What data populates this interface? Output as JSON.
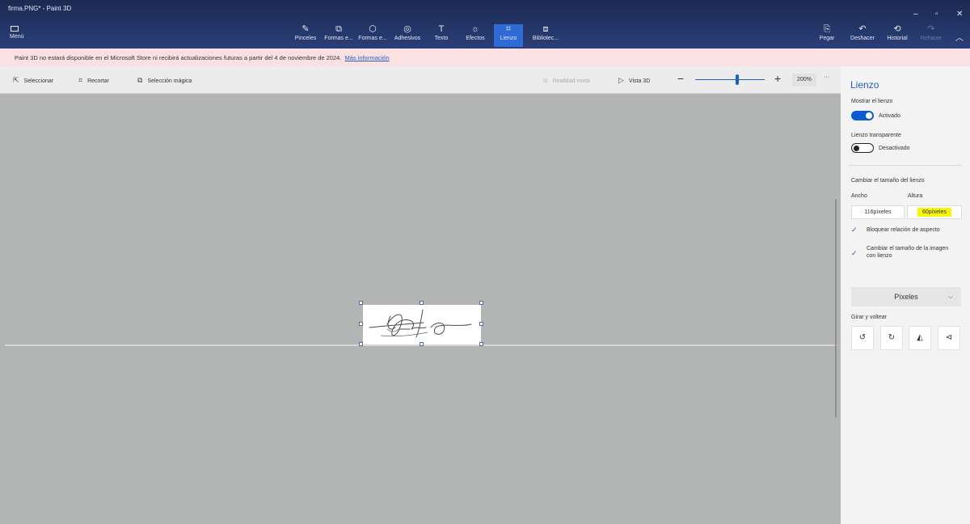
{
  "window": {
    "title": "firma.PNG* - Paint 3D"
  },
  "topbar": {
    "menu_label": "Menú",
    "tools": [
      {
        "label": "Pinceles",
        "icon": "brush-icon"
      },
      {
        "label": "Formas e...",
        "icon": "2d-shapes-icon"
      },
      {
        "label": "Formas e...",
        "icon": "3d-shapes-icon"
      },
      {
        "label": "Adhesivos",
        "icon": "stickers-icon"
      },
      {
        "label": "Texto",
        "icon": "text-icon"
      },
      {
        "label": "Efectos",
        "icon": "effects-icon"
      },
      {
        "label": "Lienzo",
        "icon": "canvas-icon"
      },
      {
        "label": "Bibliotec...",
        "icon": "library-icon"
      }
    ],
    "active_tool": "Lienzo",
    "right_actions": [
      {
        "label": "Pegar",
        "icon": "paste-icon"
      },
      {
        "label": "Deshacer",
        "icon": "undo-icon"
      },
      {
        "label": "Historial",
        "icon": "history-icon"
      },
      {
        "label": "Rehacer",
        "icon": "redo-icon"
      }
    ]
  },
  "notice": {
    "text": "Paint 3D no estará disponible en el Microsoft Store ni recibirá actualizaciones futuras a partir del 4 de noviembre de 2024.",
    "link": "Más información"
  },
  "commandbar": {
    "select": "Seleccionar",
    "crop": "Recortar",
    "magic_select": "Selección mágica",
    "mixed_reality": "Realidad mixta",
    "view3d": "Vista 3D",
    "zoom": "200%",
    "zoom_fraction": 0.6,
    "more": "···"
  },
  "panel": {
    "title": "Lienzo",
    "show_canvas_label": "Mostrar el lienzo",
    "show_canvas_state": "Activado",
    "transparent_label": "Lienzo transparente",
    "transparent_state": "Desactivado",
    "resize_label": "Cambiar el tamaño del lienzo",
    "width_label": "Ancho",
    "height_label": "Altura",
    "width_value": "116píxeles",
    "height_value": "60píxeles",
    "lock_aspect": "Bloquear relación de aspecto",
    "resize_image_line1": "Cambiar el tamaño de la imagen",
    "resize_image_line2": "con lienzo",
    "units": "Píxeles",
    "rotate_flip_label": "Girar y voltear"
  },
  "colors": {
    "accent": "#1f5fbf",
    "topbar": "#1b2a52",
    "highlight": "#f7f70a"
  }
}
